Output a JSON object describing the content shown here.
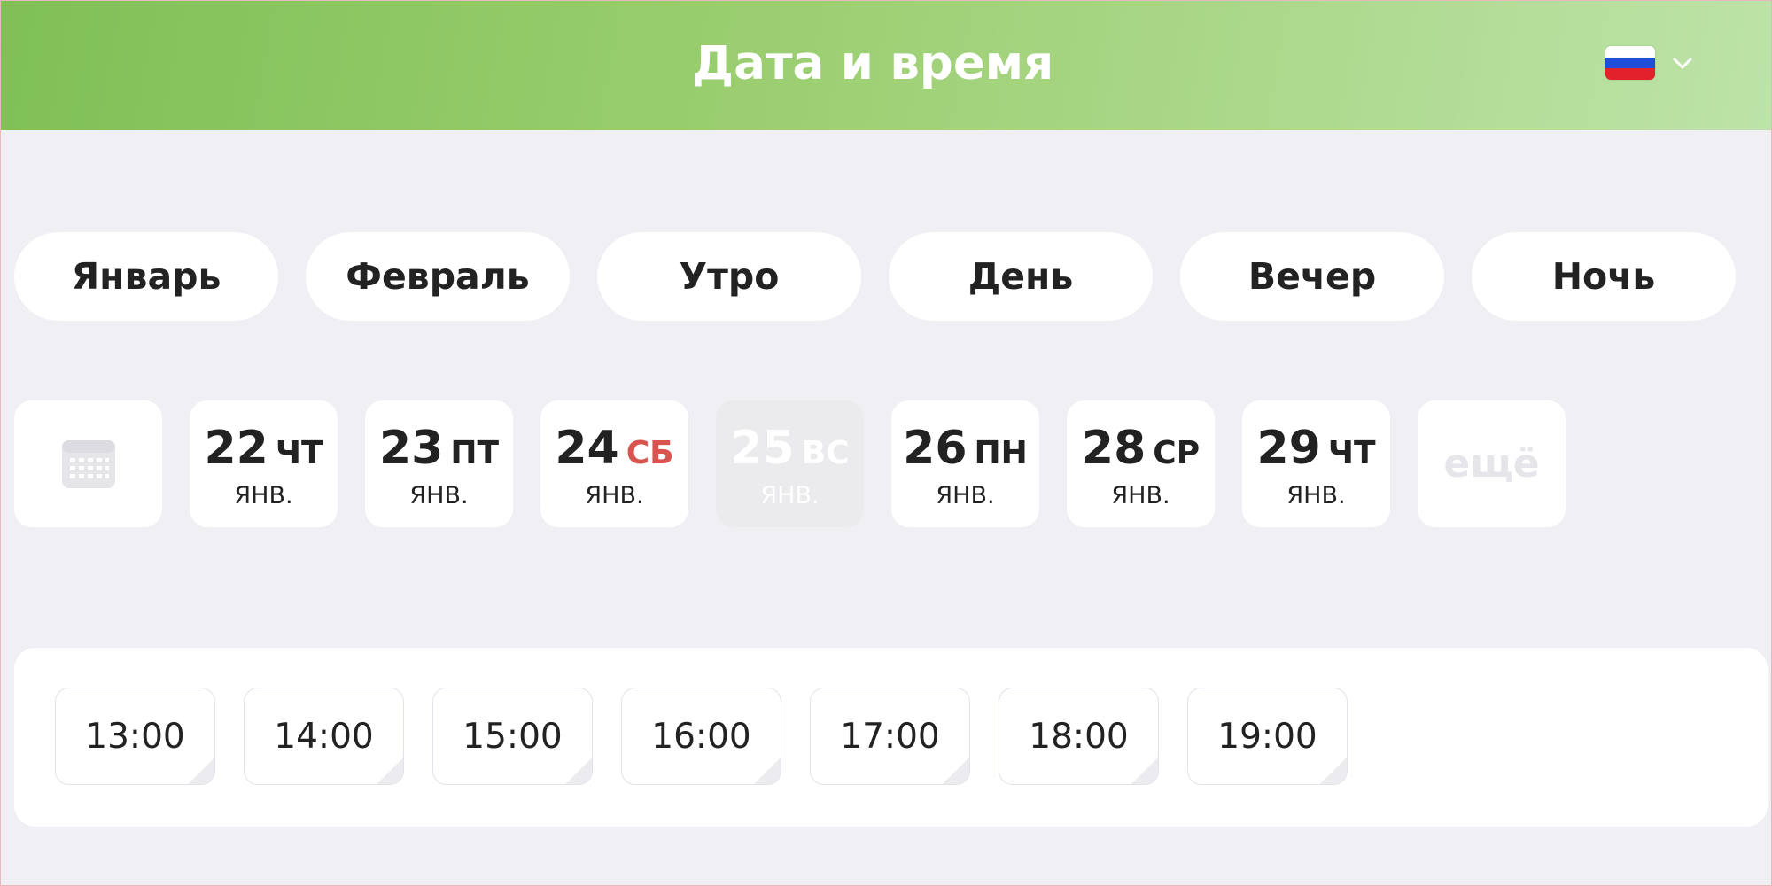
{
  "header": {
    "title": "Дата и время",
    "language": {
      "flag": "ru-flag",
      "flag_colors": [
        "#ffffff",
        "#1e4fd8",
        "#e2212a"
      ],
      "chevron": "chevron-down-icon"
    },
    "gradient_colors": [
      "#7fc056",
      "#bde3a8"
    ]
  },
  "filters": [
    {
      "label": "Январь"
    },
    {
      "label": "Февраль"
    },
    {
      "label": "Утро"
    },
    {
      "label": "День"
    },
    {
      "label": "Вечер"
    },
    {
      "label": "Ночь"
    }
  ],
  "dates": {
    "calendar_icon": "calendar-icon",
    "items": [
      {
        "day": "22",
        "weekday": "ЧТ",
        "month": "ЯНВ.",
        "weekend": false,
        "disabled": false
      },
      {
        "day": "23",
        "weekday": "ПТ",
        "month": "ЯНВ.",
        "weekend": false,
        "disabled": false
      },
      {
        "day": "24",
        "weekday": "СБ",
        "month": "ЯНВ.",
        "weekend": true,
        "disabled": false
      },
      {
        "day": "25",
        "weekday": "ВС",
        "month": "ЯНВ.",
        "weekend": true,
        "disabled": true
      },
      {
        "day": "26",
        "weekday": "ПН",
        "month": "ЯНВ.",
        "weekend": false,
        "disabled": false
      },
      {
        "day": "28",
        "weekday": "СР",
        "month": "ЯНВ.",
        "weekend": false,
        "disabled": false
      },
      {
        "day": "29",
        "weekday": "ЧТ",
        "month": "ЯНВ.",
        "weekend": false,
        "disabled": false
      }
    ],
    "more_label": "ещё",
    "weekend_color": "#d9534f"
  },
  "times": [
    "13:00",
    "14:00",
    "15:00",
    "16:00",
    "17:00",
    "18:00",
    "19:00"
  ]
}
